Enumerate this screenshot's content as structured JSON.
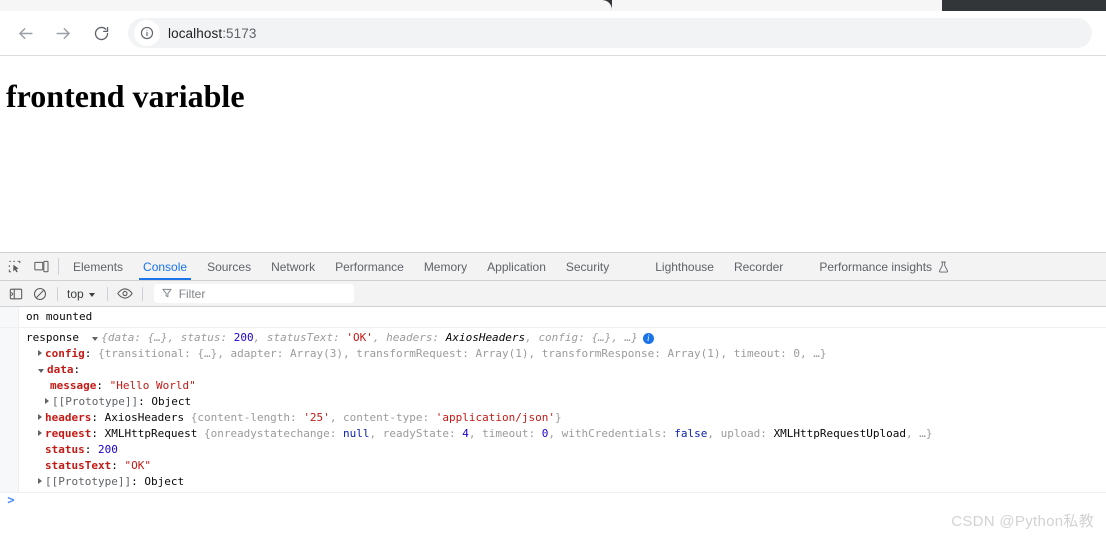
{
  "browser": {
    "back_label": "Back",
    "forward_label": "Forward",
    "reload_label": "Reload",
    "site_info_label": "View site information",
    "url_host": "localhost",
    "url_port": ":5173"
  },
  "page": {
    "heading": "frontend variable"
  },
  "devtools": {
    "icons": {
      "inspect": "inspect-element-icon",
      "device": "device-toolbar-icon"
    },
    "tabs": [
      {
        "label": "Elements",
        "active": false
      },
      {
        "label": "Console",
        "active": true
      },
      {
        "label": "Sources",
        "active": false
      },
      {
        "label": "Network",
        "active": false
      },
      {
        "label": "Performance",
        "active": false
      },
      {
        "label": "Memory",
        "active": false
      },
      {
        "label": "Application",
        "active": false
      },
      {
        "label": "Security",
        "active": false
      },
      {
        "label": "Lighthouse",
        "active": false
      },
      {
        "label": "Recorder",
        "active": false
      },
      {
        "label": "Performance insights",
        "active": false,
        "experiment": true
      }
    ],
    "console_toolbar": {
      "sidebar_label": "Show console sidebar",
      "clear_label": "Clear console",
      "context": "top",
      "eye_label": "Create live expression",
      "filter_placeholder": "Filter"
    },
    "accent_blue": "#1a73e8"
  },
  "console": {
    "messages": [
      {
        "text": "on mounted"
      }
    ],
    "response": {
      "label": "response",
      "preview": {
        "open": "{",
        "k_data": "data",
        "v_data": "{…}",
        "k_status": "status",
        "v_status": "200",
        "k_statusText": "statusText",
        "v_statusText": "'OK'",
        "k_headers": "headers",
        "v_headers": "AxiosHeaders",
        "k_config": "config",
        "v_config": "{…}",
        "ellipsis": "…",
        "close": "}",
        "info_badge": "i"
      },
      "props": [
        {
          "key": "config",
          "expanded": false,
          "value": "{transitional: {…}, adapter: Array(3), transformRequest: Array(1), transformResponse: Array(1), timeout: 0, …}"
        },
        {
          "key": "data",
          "expanded": true,
          "children": [
            {
              "key": "message",
              "value": "\"Hello World\""
            },
            {
              "key": "[[Prototype]]",
              "value": "Object"
            }
          ]
        },
        {
          "key": "headers",
          "expanded": false,
          "value": "AxiosHeaders {content-length: '25', content-type: 'application/json'}"
        },
        {
          "key": "request",
          "expanded": false,
          "value": "XMLHttpRequest {onreadystatechange: null, readyState: 4, timeout: 0, withCredentials: false, upload: XMLHttpRequestUpload, …}"
        },
        {
          "key": "status",
          "value": "200"
        },
        {
          "key": "statusText",
          "value": "\"OK\""
        },
        {
          "key": "[[Prototype]]",
          "value": "Object"
        }
      ]
    },
    "prompt": ">"
  },
  "watermark": "CSDN @Python私教"
}
